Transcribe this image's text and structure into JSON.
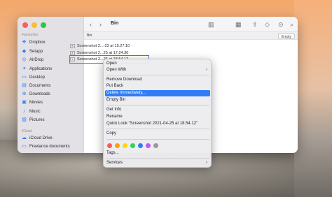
{
  "window": {
    "folder_title": "Bin"
  },
  "sidebar": {
    "favourites_label": "Favourites",
    "icloud_label": "iCloud",
    "items": [
      {
        "label": "Dropbox",
        "icon": "dropbox-icon",
        "glyph": "❖"
      },
      {
        "label": "Setapp",
        "icon": "setapp-icon",
        "glyph": "◆"
      },
      {
        "label": "AirDrop",
        "icon": "airdrop-icon",
        "glyph": "◎"
      },
      {
        "label": "Applications",
        "icon": "applications-icon",
        "glyph": "✦"
      },
      {
        "label": "Desktop",
        "icon": "desktop-icon",
        "glyph": "▭"
      },
      {
        "label": "Documents",
        "icon": "documents-icon",
        "glyph": "▤"
      },
      {
        "label": "Downloads",
        "icon": "downloads-icon",
        "glyph": "⊕"
      },
      {
        "label": "Movies",
        "icon": "movies-icon",
        "glyph": "▣"
      },
      {
        "label": "Music",
        "icon": "music-icon",
        "glyph": "♪"
      },
      {
        "label": "Pictures",
        "icon": "pictures-icon",
        "glyph": "▨"
      }
    ],
    "icloud_items": [
      {
        "label": "iCloud Drive",
        "icon": "icloud-drive-icon",
        "glyph": "☁"
      },
      {
        "label": "Freelance documents",
        "icon": "folder-icon",
        "glyph": "▭"
      }
    ]
  },
  "pathbar": {
    "label": "Bin",
    "empty_button": "Empty"
  },
  "files": [
    {
      "name": "Screenshot 2...-23 at 15.27.10"
    },
    {
      "name": "Screenshot 2...25 at 17.24.30"
    },
    {
      "name": "Screenshot 2...25 at 18.54.12"
    }
  ],
  "context_menu": {
    "open": "Open",
    "open_with": "Open With",
    "remove_download": "Remove Download",
    "put_back": "Put Back",
    "delete_immediately": "Delete Immediately...",
    "empty_bin": "Empty Bin",
    "get_info": "Get Info",
    "rename": "Rename",
    "quick_look": "Quick Look “Screenshot 2021-04-25 at 18.54.12”",
    "copy": "Copy",
    "tags": "Tags...",
    "services": "Services",
    "tag_colors": [
      "#ff5a52",
      "#ff9f0a",
      "#ffd60a",
      "#30d158",
      "#2f7cf6",
      "#bf5af2",
      "#98989d"
    ]
  },
  "colors": {
    "accent": "#2f7cf6"
  }
}
